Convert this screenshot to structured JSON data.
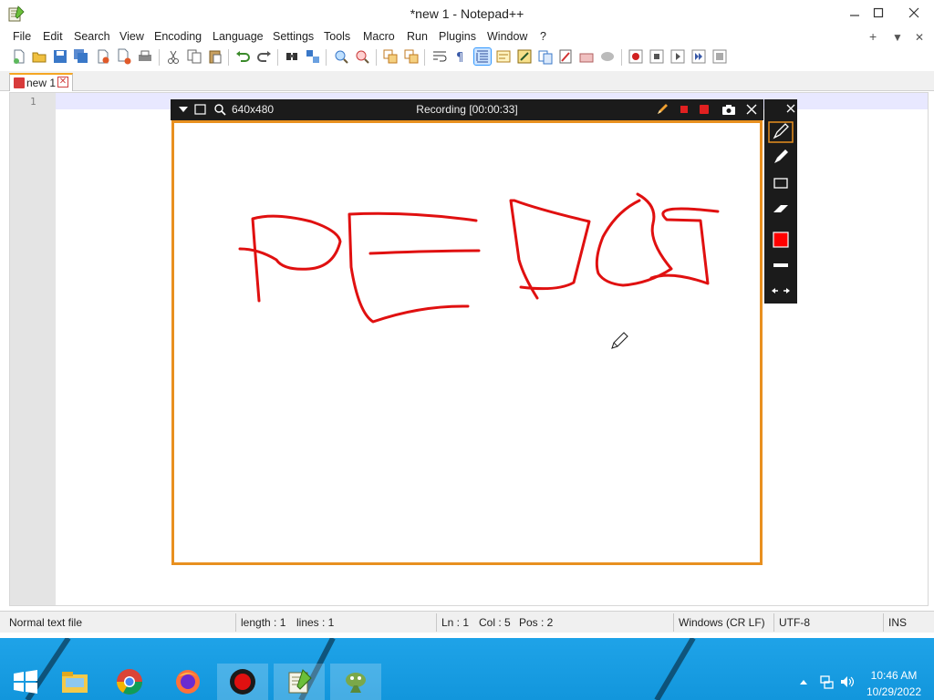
{
  "window": {
    "title": "*new 1 - Notepad++",
    "icons": {
      "app": "notepad-plus-plus-icon",
      "minimize": "minimize-icon",
      "maximize": "maximize-icon",
      "close": "close-icon"
    }
  },
  "menu": {
    "items": [
      "File",
      "Edit",
      "Search",
      "View",
      "Encoding",
      "Language",
      "Settings",
      "Tools",
      "Macro",
      "Run",
      "Plugins",
      "Window",
      "?"
    ],
    "right": [
      "+",
      "▼",
      "✕"
    ]
  },
  "toolbar": {
    "buttons": [
      "new-file",
      "open-file",
      "save",
      "save-all",
      "close",
      "close-all",
      "print",
      "cut",
      "copy",
      "paste",
      "undo",
      "redo",
      "find",
      "replace",
      "zoom-in",
      "zoom-out",
      "sync-vertical",
      "sync-horizontal",
      "word-wrap",
      "show-all-characters",
      "indent-guide",
      "user-defined-language",
      "document-map",
      "function-list",
      "folder-as-workspace",
      "monitoring",
      "record-macro",
      "stop-macro",
      "play-macro",
      "run-macro-multiple",
      "save-macro"
    ],
    "active": "indent-guide"
  },
  "tab": {
    "label": "new 1",
    "icon": "unsaved-file-icon",
    "close_icon": "tab-close-icon"
  },
  "editor": {
    "line_number": "1"
  },
  "recorder": {
    "size_label": "640x480",
    "status": "Recording [00:00:33]",
    "colors": {
      "frame": "#e8901f",
      "ink": "#e01010",
      "toolbar": "#1b1b1b"
    },
    "icons": [
      "dropdown-arrow-icon",
      "window-icon",
      "magnifier-icon",
      "pencil-icon",
      "stop-icon",
      "record-icon",
      "camera-icon",
      "close-icon"
    ],
    "tools": [
      "pen-tool-icon",
      "highlighter-tool-icon",
      "rectangle-tool-icon",
      "eraser-tool-icon",
      "color-swatch-icon",
      "line-width-icon",
      "undo-redo-arrows-icon"
    ],
    "selected_tool": "pen-tool-icon",
    "selected_color": "#ff0000"
  },
  "status": {
    "file_type": "Normal text file",
    "length": "length : 1",
    "lines": "lines : 1",
    "ln": "Ln : 1",
    "col": "Col : 5",
    "pos": "Pos : 2",
    "eol": "Windows (CR LF)",
    "encoding": "UTF-8",
    "mode": "INS"
  },
  "taskbar": {
    "apps": [
      "start-icon",
      "file-explorer-icon",
      "chrome-icon",
      "firefox-icon",
      "screen-recorder-icon",
      "notepad-plus-plus-icon",
      "regex-tool-icon"
    ],
    "open": [
      "screen-recorder-icon",
      "notepad-plus-plus-icon",
      "regex-tool-icon"
    ],
    "time": "10:46 AM",
    "date": "10/29/2022",
    "tray": [
      "show-hidden-icons-icon",
      "network-icon",
      "volume-icon"
    ]
  }
}
